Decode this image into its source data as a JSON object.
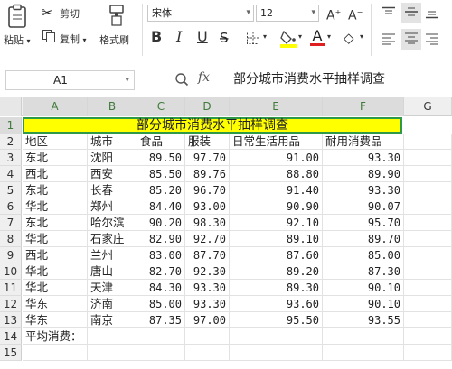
{
  "ribbon": {
    "paste_label": "粘贴",
    "cut_label": "剪切",
    "copy_label": "复制",
    "format_painter_label": "格式刷",
    "font_name": "宋体",
    "font_size": "12",
    "bold_label": "B",
    "italic_label": "I",
    "underline_label": "U",
    "font_color_label": "A"
  },
  "formula_bar": {
    "cell_ref": "A1",
    "fx_label": "fx",
    "content": "部分城市消费水平抽样调查"
  },
  "columns": [
    "A",
    "B",
    "C",
    "D",
    "E",
    "F",
    "G"
  ],
  "title": "部分城市消费水平抽样调查",
  "headers": [
    "地区",
    "城市",
    "食品",
    "服装",
    "日常生活用品",
    "耐用消费品"
  ],
  "rows": [
    [
      "东北",
      "沈阳",
      "89.50",
      "97.70",
      "91.00",
      "93.30"
    ],
    [
      "西北",
      "西安",
      "85.50",
      "89.76",
      "88.80",
      "89.90"
    ],
    [
      "东北",
      "长春",
      "85.20",
      "96.70",
      "91.40",
      "93.30"
    ],
    [
      "华北",
      "郑州",
      "84.40",
      "93.00",
      "90.90",
      "90.07"
    ],
    [
      "东北",
      "哈尔滨",
      "90.20",
      "98.30",
      "92.10",
      "95.70"
    ],
    [
      "华北",
      "石家庄",
      "82.90",
      "92.70",
      "89.10",
      "89.70"
    ],
    [
      "西北",
      "兰州",
      "83.00",
      "87.70",
      "87.60",
      "85.00"
    ],
    [
      "华北",
      "唐山",
      "82.70",
      "92.30",
      "89.20",
      "87.30"
    ],
    [
      "华北",
      "天津",
      "84.30",
      "93.30",
      "89.30",
      "90.10"
    ],
    [
      "华东",
      "济南",
      "85.00",
      "93.30",
      "93.60",
      "90.10"
    ],
    [
      "华东",
      "南京",
      "87.35",
      "97.00",
      "95.50",
      "93.55"
    ]
  ],
  "average_label": "平均消费：",
  "row_numbers": [
    "1",
    "2",
    "3",
    "4",
    "5",
    "6",
    "7",
    "8",
    "9",
    "10",
    "11",
    "12",
    "13",
    "14",
    "15"
  ]
}
